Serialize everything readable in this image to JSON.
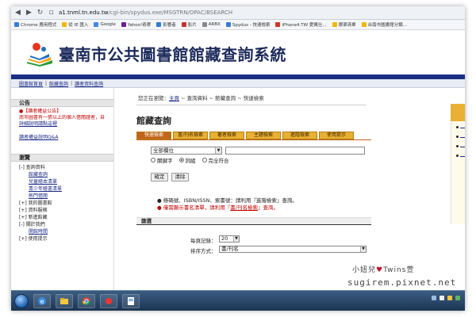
{
  "browser": {
    "url_host": "a1.tnml.tn.edu.tw",
    "url_path": "/cgi-bin/spydus.exe/MSGTRN/OPAC/BSEARCH",
    "bookmarks": [
      {
        "label": "Chrome 應用程式",
        "color": "#3a7bd5"
      },
      {
        "label": "從 IE 匯入",
        "color": "#f2b705"
      },
      {
        "label": "Google",
        "color": "#4285f4"
      },
      {
        "label": "Yahoo!奇摩",
        "color": "#6b1f9b"
      },
      {
        "label": "影響者",
        "color": "#2f7dd1"
      },
      {
        "label": "影片",
        "color": "#c9302c"
      },
      {
        "label": "ARBX",
        "color": "#888888"
      },
      {
        "label": "Spydus - 快速檢索",
        "color": "#3a7bd5"
      },
      {
        "label": "iPhone4.TW 愛瘋仕...",
        "color": "#d4352b"
      },
      {
        "label": "眼罩清單",
        "color": "#f2b705"
      },
      {
        "label": "台南市圖書館分類...",
        "color": "#f2b705"
      }
    ]
  },
  "header": {
    "title": "臺南市公共圖書館館藏查詢系統"
  },
  "topnav": {
    "items": [
      "圖書館首頁",
      "館藏查詢",
      "讀者資料查詢"
    ],
    "separator": "|"
  },
  "sidebar": {
    "announcement_title": "公告",
    "announcement_highlight": "●【讀者權益公告】",
    "announcement_text": "南市圖書有一張以上的個人借閱證者，自",
    "announcement_link1": "詳細說明請點這裡",
    "announcement_link2": "讀者權益說明Q&A",
    "browse_title": "瀏覽",
    "tree": [
      {
        "label": "[-] 查詢資料",
        "type": "grp"
      },
      {
        "label": "館藏查詢",
        "type": "child"
      },
      {
        "label": "兒童繪本清單",
        "type": "child"
      },
      {
        "label": "青少年繪書清單",
        "type": "child"
      },
      {
        "label": "熱門借閱",
        "type": "child"
      },
      {
        "label": "[+] 我的圖書館",
        "type": "grp"
      },
      {
        "label": "[+] 資料服務",
        "type": "grp"
      },
      {
        "label": "[+] 新進館藏",
        "type": "grp"
      },
      {
        "label": "[-] 關於我們",
        "type": "grp"
      },
      {
        "label": "開館時間",
        "type": "child"
      },
      {
        "label": "[+] 使用提示",
        "type": "grp"
      }
    ]
  },
  "main": {
    "breadcrumb_prefix": "您正在瀏覽：",
    "breadcrumb_home": "主頁",
    "breadcrumb_rest": " ~ 查詢資料 ~ 館藏查詢 ~ 快速檢索",
    "page_title": "館藏查詢",
    "tabs": [
      "快速檢索",
      "書/刊名檢索",
      "著者檢索",
      "主題檢索",
      "進階檢索",
      "使用提示"
    ],
    "field_select": "全部欄位",
    "query_value": "",
    "radios": [
      {
        "label": "關鍵字",
        "checked": false
      },
      {
        "label": "詞組",
        "checked": true
      },
      {
        "label": "完全符合",
        "checked": false
      }
    ],
    "submit_label": "確定",
    "clear_label": "清除",
    "note1": "● 條碼號、ISBN/ISSN、索書號：請利用『進階檢索』查詢。",
    "note2_pre": "● 僅需顯示書名清單，請利用『",
    "note2_link": "書/刊名檢索",
    "note2_post": "』查詢。",
    "sort_header": "篩選",
    "per_page_label": "每頁記錄：",
    "per_page_value": "20",
    "sort_label": "排序方式：",
    "sort_value": "書/刊名"
  },
  "watermark": {
    "line1_a": "小妞兒",
    "heart": "♥",
    "line1_b": "Twins萱",
    "line2": "sugirem.pixnet.net"
  }
}
